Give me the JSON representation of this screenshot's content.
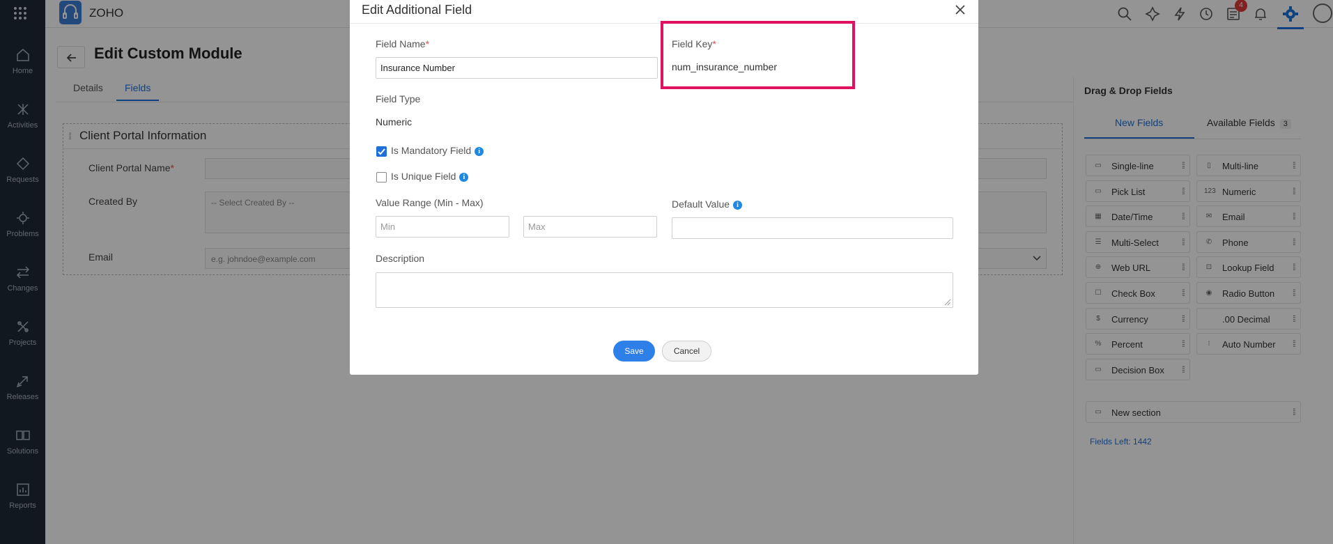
{
  "app": {
    "brand": "ZOHO",
    "notification_count": "4"
  },
  "leftnav": [
    {
      "label": "Home",
      "icon": "home-icon"
    },
    {
      "label": "Activities",
      "icon": "activities-icon"
    },
    {
      "label": "Requests",
      "icon": "requests-icon"
    },
    {
      "label": "Problems",
      "icon": "problems-icon"
    },
    {
      "label": "Changes",
      "icon": "changes-icon"
    },
    {
      "label": "Projects",
      "icon": "projects-icon"
    },
    {
      "label": "Releases",
      "icon": "releases-icon"
    },
    {
      "label": "Solutions",
      "icon": "solutions-icon"
    },
    {
      "label": "Reports",
      "icon": "reports-icon"
    }
  ],
  "page": {
    "title": "Edit Custom Module",
    "tabs": [
      "Details",
      "Fields"
    ],
    "section_title": "Client Portal Information",
    "fields": [
      {
        "label": "Client Portal Name",
        "required": "*",
        "placeholder": ""
      },
      {
        "label": "Created By",
        "placeholder": "-- Select Created By --"
      },
      {
        "label": "Email",
        "placeholder": "e.g. johndoe@example.com"
      }
    ]
  },
  "rightpanel": {
    "title": "Drag & Drop Fields",
    "tabs": {
      "new": "New Fields",
      "available": "Available Fields",
      "available_count": "3"
    },
    "chips": [
      {
        "label": "Single-line",
        "icon": "▭"
      },
      {
        "label": "Multi-line",
        "icon": "▯"
      },
      {
        "label": "Pick List",
        "icon": "▭"
      },
      {
        "label": "Numeric",
        "icon": "123"
      },
      {
        "label": "Date/Time",
        "icon": "▦"
      },
      {
        "label": "Email",
        "icon": "✉"
      },
      {
        "label": "Multi-Select",
        "icon": "☰"
      },
      {
        "label": "Phone",
        "icon": "✆"
      },
      {
        "label": "Web URL",
        "icon": "⊕"
      },
      {
        "label": "Lookup Field",
        "icon": "⊡"
      },
      {
        "label": "Check Box",
        "icon": "☐"
      },
      {
        "label": "Radio Button",
        "icon": "◉"
      },
      {
        "label": "Currency",
        "icon": "$"
      },
      {
        "label": ".00 Decimal",
        "icon": ""
      },
      {
        "label": "Percent",
        "icon": "%"
      },
      {
        "label": "Auto Number",
        "icon": "⁝"
      },
      {
        "label": "Decision Box",
        "icon": "▭"
      }
    ],
    "new_section": "New section",
    "fields_left": "Fields Left: 1442"
  },
  "modal": {
    "title": "Edit Additional Field",
    "field_name_label": "Field Name",
    "field_name_value": "Insurance Number",
    "field_key_label": "Field Key",
    "field_key_value": "num_insurance_number",
    "required_mark": "*",
    "field_type_label": "Field Type",
    "field_type_value": "Numeric",
    "mandatory_label": "Is Mandatory Field",
    "mandatory_checked": true,
    "unique_label": "Is Unique Field",
    "unique_checked": false,
    "value_range_label": "Value Range (Min - Max)",
    "min_placeholder": "Min",
    "max_placeholder": "Max",
    "default_value_label": "Default Value",
    "description_label": "Description",
    "save_label": "Save",
    "cancel_label": "Cancel",
    "info_glyph": "i"
  },
  "colors": {
    "accent": "#1e6fd9",
    "highlight": "#e0115f",
    "nav_bg": "#1f2a37"
  }
}
